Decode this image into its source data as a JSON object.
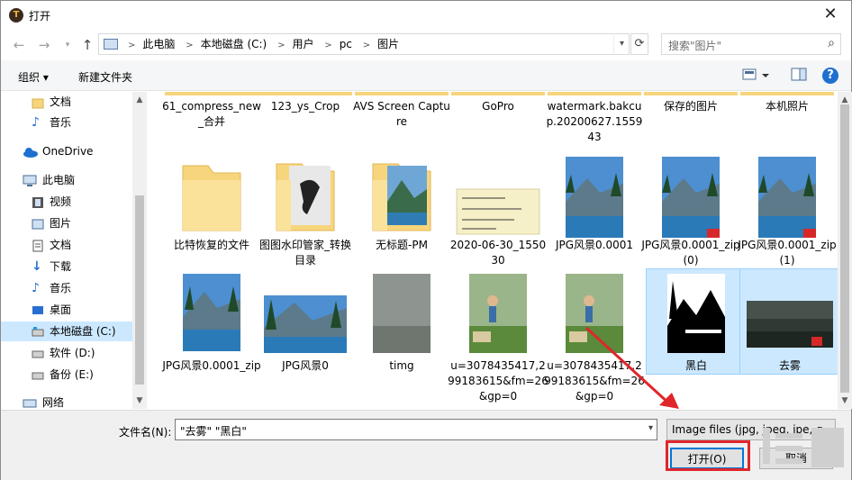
{
  "window": {
    "title": "打开",
    "app_icon_letter": "T"
  },
  "address": {
    "crumbs": [
      "此电脑",
      "本地磁盘 (C:)",
      "用户",
      "pc",
      "图片"
    ],
    "search_placeholder": "搜索\"图片\""
  },
  "toolbar": {
    "organize": "组织 ▾",
    "new_folder": "新建文件夹"
  },
  "nav": [
    {
      "label": "文档",
      "icon": "folder-icon"
    },
    {
      "label": "音乐",
      "icon": "music-icon"
    },
    {
      "label": "OneDrive",
      "icon": "cloud-icon"
    },
    {
      "label": "此电脑",
      "icon": "pc-icon"
    },
    {
      "label": "视频",
      "icon": "video-icon"
    },
    {
      "label": "图片",
      "icon": "picture-icon"
    },
    {
      "label": "文档",
      "icon": "document-icon"
    },
    {
      "label": "下载",
      "icon": "download-icon"
    },
    {
      "label": "音乐",
      "icon": "music-icon"
    },
    {
      "label": "桌面",
      "icon": "desktop-icon"
    },
    {
      "label": "本地磁盘 (C:)",
      "icon": "drive-icon"
    },
    {
      "label": "软件 (D:)",
      "icon": "drive-icon"
    },
    {
      "label": "备份 (E:)",
      "icon": "drive-icon"
    },
    {
      "label": "网络",
      "icon": "network-icon"
    }
  ],
  "files": {
    "row1": [
      "61_compress_new_合并",
      "123_ys_Crop",
      "AVS Screen Capture",
      "GoPro",
      "watermark.bakcup.20200627.155943",
      "保存的图片",
      "本机照片"
    ],
    "row2": [
      "比特恢复的文件",
      "图图水印管家_转换目录",
      "无标题-PM",
      "2020-06-30_155030",
      "JPG风景0.0001",
      "JPG风景0.0001_zip(0)",
      "JPG风景0.0001_zip(1)"
    ],
    "row3": [
      "JPG风景0.0001_zip",
      "JPG风景0",
      "timg",
      "u=3078435417,299183615&fm=26&gp=0",
      "u=3078435417,299183615&fm=26&gp=0",
      "黑白",
      "去雾"
    ]
  },
  "bottom": {
    "filename_label": "文件名(N):",
    "filename_value": "\"去雾\" \"黑白\"",
    "filetype": "Image files (jpg, jpeg, jpe, g",
    "open_button": "打开(O)",
    "cancel_button": "取消"
  },
  "colors": {
    "selection": "#cce8ff",
    "accent": "#0078d7",
    "annotation_red": "#e0262b"
  }
}
